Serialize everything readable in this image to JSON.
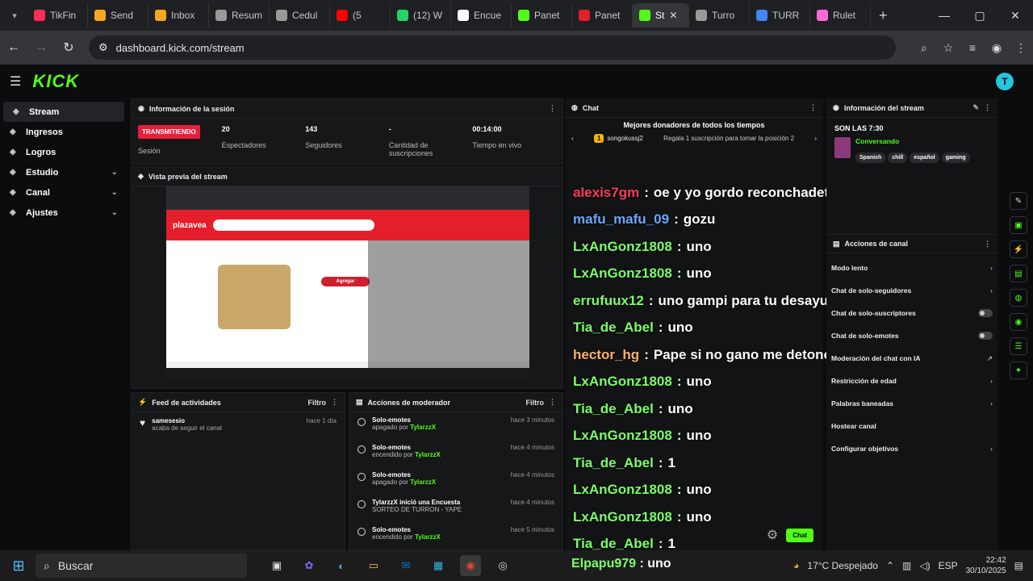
{
  "browser": {
    "tabs": [
      {
        "label": "TikFin",
        "color": "#fe2c55",
        "active": false
      },
      {
        "label": "Send",
        "color": "#f5a623",
        "active": false
      },
      {
        "label": "Inbox",
        "color": "#f5a623",
        "active": false
      },
      {
        "label": "Resum",
        "color": "#999999",
        "active": false
      },
      {
        "label": "Cedul",
        "color": "#999999",
        "active": false
      },
      {
        "label": "(5",
        "color": "#ff0000",
        "active": false
      },
      {
        "label": "(12) W",
        "color": "#25d366",
        "active": false
      },
      {
        "label": "Encue",
        "color": "#ffffff",
        "active": false
      },
      {
        "label": "Panet",
        "color": "#53fc18",
        "active": false
      },
      {
        "label": "Panet",
        "color": "#e41e2b",
        "active": false
      },
      {
        "label": "St",
        "color": "#53fc18",
        "active": true
      },
      {
        "label": "Turro",
        "color": "#999999",
        "active": false
      },
      {
        "label": "TURR",
        "color": "#4285f4",
        "active": false
      },
      {
        "label": "Rulet",
        "color": "#ff6ad5",
        "active": false
      }
    ],
    "url": "dashboard.kick.com/stream"
  },
  "app": {
    "logo": "KICK",
    "sidebar": [
      {
        "label": "Stream",
        "icon": "broadcast-icon",
        "active": true,
        "expand": false
      },
      {
        "label": "Ingresos",
        "icon": "money-icon",
        "active": false,
        "expand": false
      },
      {
        "label": "Logros",
        "icon": "trophy-icon",
        "active": false,
        "expand": false
      },
      {
        "label": "Estudio",
        "icon": "studio-icon",
        "active": false,
        "expand": true
      },
      {
        "label": "Canal",
        "icon": "channel-icon",
        "active": false,
        "expand": true
      },
      {
        "label": "Ajustes",
        "icon": "gear-icon",
        "active": false,
        "expand": true
      }
    ],
    "session": {
      "title": "Información de la sesión",
      "badge": "TRANSMITIENDO",
      "badge_label": "Sesión",
      "stats": [
        {
          "value": "20",
          "label": "Espectadores"
        },
        {
          "value": "143",
          "label": "Seguidores"
        },
        {
          "value": "-",
          "label": "Cantidad de suscripciones"
        },
        {
          "value": "00:14:00",
          "label": "Tiempo en vivo"
        }
      ]
    },
    "preview": {
      "title": "Vista previa del stream",
      "site": "plazavea",
      "button": "Agregar"
    },
    "feed": {
      "title": "Feed de actividades",
      "filter": "Filtro",
      "items": [
        {
          "user": "samesesio",
          "action": "acaba de seguir el canal",
          "time": "hace 1 día"
        }
      ]
    },
    "mod": {
      "title": "Acciones de moderador",
      "filter": "Filtro",
      "items": [
        {
          "title": "Solo-emotes",
          "sub": "apagado por",
          "user": "TylarzzX",
          "time": "hace 3 minutos"
        },
        {
          "title": "Solo-emotes",
          "sub": "encendido por",
          "user": "TylarzzX",
          "time": "hace 4 minutos"
        },
        {
          "title": "Solo-emotes",
          "sub": "apagado por",
          "user": "TylarzzX",
          "time": "hace 4 minutos"
        },
        {
          "title": "TylarzzX inició una Encuesta",
          "sub": "SORTEO DE TURRON - YAPE",
          "user": "",
          "time": "hace 4 minutos"
        },
        {
          "title": "Solo-emotes",
          "sub": "encendido por",
          "user": "TylarzzX",
          "time": "hace 5 minutos"
        }
      ]
    },
    "chat": {
      "title": "Chat",
      "donors_title": "Mejores donadores de todos los tiempos",
      "donor_name": "songokussj2",
      "donor_rank": "1",
      "donor_promo": "Regala 1 suscripción para tomar la posición 2",
      "send": "Chat",
      "messages": [
        {
          "user": "alexis7gm",
          "color": "#ff3b5c",
          "text": "oe y yo gordo reconchadetumadre"
        },
        {
          "user": "mafu_mafu_09",
          "color": "#6aa8ff",
          "text": "gozu"
        },
        {
          "user": "LxAnGonz1808",
          "color": "#7dff6a",
          "text": "uno"
        },
        {
          "user": "LxAnGonz1808",
          "color": "#7dff6a",
          "text": "uno"
        },
        {
          "user": "errufuux12",
          "color": "#7dff6a",
          "text": "uno gampi para tu desayuno"
        },
        {
          "user": "Tia_de_Abel",
          "color": "#7dff6a",
          "text": "uno"
        },
        {
          "user": "hector_hg",
          "color": "#ffb26a",
          "text": "Pape si no gano me detonó a carlitos"
        },
        {
          "user": "LxAnGonz1808",
          "color": "#7dff6a",
          "text": "uno"
        },
        {
          "user": "Tia_de_Abel",
          "color": "#7dff6a",
          "text": "uno"
        },
        {
          "user": "LxAnGonz1808",
          "color": "#7dff6a",
          "text": "uno"
        },
        {
          "user": "Tia_de_Abel",
          "color": "#7dff6a",
          "text": "1"
        },
        {
          "user": "LxAnGonz1808",
          "color": "#7dff6a",
          "text": "uno"
        },
        {
          "user": "LxAnGonz1808",
          "color": "#7dff6a",
          "text": "uno"
        },
        {
          "user": "Tia_de_Abel",
          "color": "#7dff6a",
          "text": "1"
        }
      ]
    },
    "stream_info": {
      "title": "Información del stream",
      "stream_title": "SON LAS 7:30",
      "category": "Conversando",
      "tags": [
        "Spanish",
        "chill",
        "español",
        "gaming"
      ]
    },
    "channel_actions": {
      "title": "Acciones de canal",
      "items": [
        {
          "label": "Modo lento",
          "control": "chevron"
        },
        {
          "label": "Chat de solo-seguidores",
          "control": "chevron"
        },
        {
          "label": "Chat de solo-suscriptores",
          "control": "toggle"
        },
        {
          "label": "Chat de solo-emotes",
          "control": "toggle"
        },
        {
          "label": "Moderación del chat con IA",
          "control": "link"
        },
        {
          "label": "Restricción de edad",
          "control": "chevron"
        },
        {
          "label": "Palabras baneadas",
          "control": "chevron"
        },
        {
          "label": "Hostear canal",
          "control": "none"
        },
        {
          "label": "Configurar objetivos",
          "control": "chevron"
        }
      ]
    }
  },
  "overlay": {
    "user": "Elpapu979",
    "text": "uno"
  },
  "taskbar": {
    "search": "Buscar",
    "weather": "17°C Despejado",
    "lang": "ESP",
    "time": "22:42",
    "date": "30/10/2025"
  }
}
